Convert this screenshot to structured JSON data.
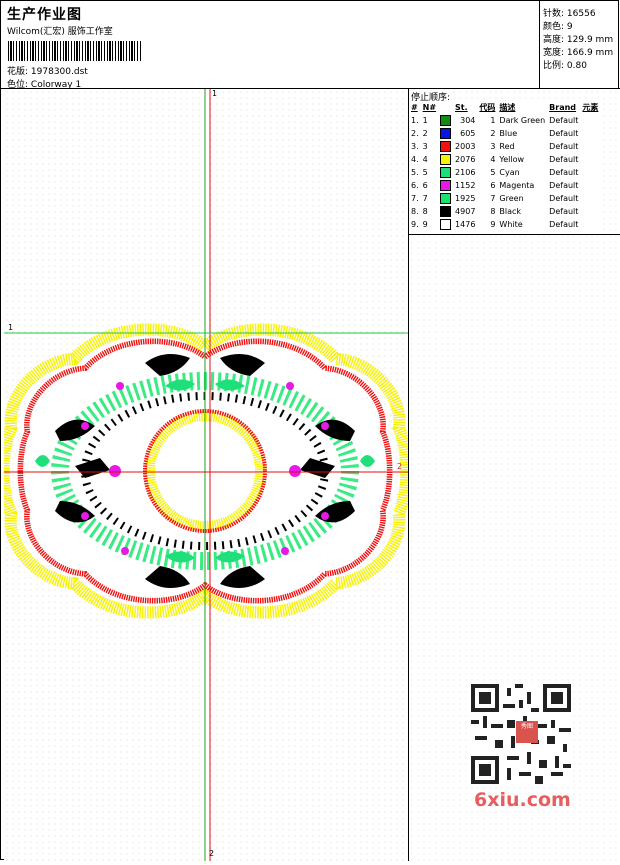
{
  "header": {
    "title": "生产作业图",
    "studio": "Wilcom(汇宏) 服饰工作室",
    "design_label": "花版:",
    "design_value": "1978300.dst",
    "colorway_label": "色位:",
    "colorway_value": "Colorway 1"
  },
  "stats": {
    "stitches_label": "针数:",
    "stitches_value": "16556",
    "colors_label": "颜色:",
    "colors_value": "9",
    "height_label": "高度:",
    "height_value": "129.9 mm",
    "width_label": "宽度:",
    "width_value": "166.9 mm",
    "scale_label": "比例:",
    "scale_value": "0.80"
  },
  "stop_sequence": {
    "title": "停止顺序:",
    "columns": [
      "#",
      "N#",
      "St.",
      "代码",
      "描述",
      "Brand",
      "元素"
    ],
    "rows": [
      {
        "seq": "1.",
        "n": "1",
        "color": "#138a13",
        "st": "304",
        "code": "1",
        "desc": "Dark Green",
        "brand": "Default"
      },
      {
        "seq": "2.",
        "n": "2",
        "color": "#0a14e6",
        "st": "605",
        "code": "2",
        "desc": "Blue",
        "brand": "Default"
      },
      {
        "seq": "3.",
        "n": "3",
        "color": "#f01010",
        "st": "2003",
        "code": "3",
        "desc": "Red",
        "brand": "Default"
      },
      {
        "seq": "4.",
        "n": "4",
        "color": "#f7f20a",
        "st": "2076",
        "code": "4",
        "desc": "Yellow",
        "brand": "Default"
      },
      {
        "seq": "5.",
        "n": "5",
        "color": "#1edf7a",
        "st": "2106",
        "code": "5",
        "desc": "Cyan",
        "brand": "Default"
      },
      {
        "seq": "6.",
        "n": "6",
        "color": "#e619e6",
        "st": "1152",
        "code": "6",
        "desc": "Magenta",
        "brand": "Default"
      },
      {
        "seq": "7.",
        "n": "7",
        "color": "#17e66c",
        "st": "1925",
        "code": "7",
        "desc": "Green",
        "brand": "Default"
      },
      {
        "seq": "8.",
        "n": "8",
        "color": "#000000",
        "st": "4907",
        "code": "8",
        "desc": "Black",
        "brand": "Default"
      },
      {
        "seq": "9.",
        "n": "9",
        "color": "#ffffff",
        "st": "1476",
        "code": "9",
        "desc": "White",
        "brand": "Default"
      }
    ]
  },
  "guides": {
    "v_top": "1",
    "v_bottom": "2",
    "h_left": "1",
    "h_right": "2",
    "vertical_green_color": "#1aa31a",
    "vertical_red_color": "#e01010",
    "horizontal_green_color": "#22c93a",
    "horizontal_red_color": "#e01010"
  },
  "watermark": {
    "text": "6xiu.com",
    "stamp": "秀图"
  },
  "design_icon": "floral-embroidery-medallion"
}
